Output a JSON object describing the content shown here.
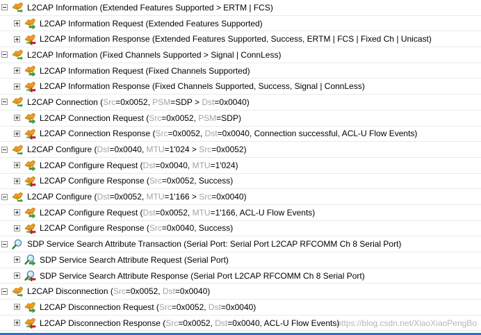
{
  "rows": [
    {
      "level": 0,
      "icon": "l2cap-icon",
      "segments": [
        {
          "t": "L2CAP Information (Extended Features Supported > ERTM | FCS)"
        }
      ]
    },
    {
      "level": 1,
      "icon": "l2cap-request-icon",
      "segments": [
        {
          "t": "L2CAP Information Request (Extended Features Supported)"
        }
      ]
    },
    {
      "level": 1,
      "icon": "l2cap-response-icon",
      "segments": [
        {
          "t": "L2CAP Information Response (Extended Features Supported, Success, ERTM | FCS | Fixed Ch | Unicast)"
        }
      ]
    },
    {
      "level": 0,
      "icon": "l2cap-icon",
      "segments": [
        {
          "t": "L2CAP Information (Fixed Channels Supported > Signal | ConnLess)"
        }
      ]
    },
    {
      "level": 1,
      "icon": "l2cap-request-icon",
      "segments": [
        {
          "t": "L2CAP Information Request (Fixed Channels Supported)"
        }
      ]
    },
    {
      "level": 1,
      "icon": "l2cap-response-icon",
      "segments": [
        {
          "t": "L2CAP Information Response (Fixed Channels Supported, Success, Signal | ConnLess)"
        }
      ]
    },
    {
      "level": 0,
      "icon": "l2cap-icon",
      "segments": [
        {
          "t": "L2CAP Connection ("
        },
        {
          "t": "Src",
          "k": true
        },
        {
          "t": "=0x0052, "
        },
        {
          "t": "PSM",
          "k": true
        },
        {
          "t": "=SDP > "
        },
        {
          "t": "Dst",
          "k": true
        },
        {
          "t": "=0x0040)"
        }
      ]
    },
    {
      "level": 1,
      "icon": "l2cap-request-icon",
      "segments": [
        {
          "t": "L2CAP Connection Request ("
        },
        {
          "t": "Src",
          "k": true
        },
        {
          "t": "=0x0052, "
        },
        {
          "t": "PSM",
          "k": true
        },
        {
          "t": "=SDP)"
        }
      ]
    },
    {
      "level": 1,
      "icon": "l2cap-response-icon",
      "segments": [
        {
          "t": "L2CAP Connection Response ("
        },
        {
          "t": "Src",
          "k": true
        },
        {
          "t": "=0x0052, "
        },
        {
          "t": "Dst",
          "k": true
        },
        {
          "t": "=0x0040, Connection successful, ACL-U Flow Events)"
        }
      ]
    },
    {
      "level": 0,
      "icon": "l2cap-icon",
      "segments": [
        {
          "t": "L2CAP Configure ("
        },
        {
          "t": "Dst",
          "k": true
        },
        {
          "t": "=0x0040, "
        },
        {
          "t": "MTU",
          "k": true
        },
        {
          "t": "=1'024 > "
        },
        {
          "t": "Src",
          "k": true
        },
        {
          "t": "=0x0052)"
        }
      ]
    },
    {
      "level": 1,
      "icon": "l2cap-request-icon",
      "segments": [
        {
          "t": "L2CAP Configure Request ("
        },
        {
          "t": "Dst",
          "k": true
        },
        {
          "t": "=0x0040, "
        },
        {
          "t": "MTU",
          "k": true
        },
        {
          "t": "=1'024)"
        }
      ]
    },
    {
      "level": 1,
      "icon": "l2cap-response-icon",
      "segments": [
        {
          "t": "L2CAP Configure Response ("
        },
        {
          "t": "Src",
          "k": true
        },
        {
          "t": "=0x0052, Success)"
        }
      ]
    },
    {
      "level": 0,
      "icon": "l2cap-icon",
      "segments": [
        {
          "t": "L2CAP Configure ("
        },
        {
          "t": "Dst",
          "k": true
        },
        {
          "t": "=0x0052, "
        },
        {
          "t": "MTU",
          "k": true
        },
        {
          "t": "=1'166 > "
        },
        {
          "t": "Src",
          "k": true
        },
        {
          "t": "=0x0040)"
        }
      ]
    },
    {
      "level": 1,
      "icon": "l2cap-request-icon",
      "segments": [
        {
          "t": "L2CAP Configure Request ("
        },
        {
          "t": "Dst",
          "k": true
        },
        {
          "t": "=0x0052, "
        },
        {
          "t": "MTU",
          "k": true
        },
        {
          "t": "=1'166, ACL-U Flow Events)"
        }
      ]
    },
    {
      "level": 1,
      "icon": "l2cap-response-icon",
      "segments": [
        {
          "t": "L2CAP Configure Response ("
        },
        {
          "t": "Src",
          "k": true
        },
        {
          "t": "=0x0040, Success)"
        }
      ]
    },
    {
      "level": 0,
      "icon": "sdp-icon",
      "segments": [
        {
          "t": "SDP Service Search Attribute Transaction (Serial Port: Serial Port L2CAP RFCOMM Ch 8 Serial Port)"
        }
      ]
    },
    {
      "level": 1,
      "icon": "sdp-request-icon",
      "segments": [
        {
          "t": "SDP Service Search Attribute Request (Serial Port)"
        }
      ]
    },
    {
      "level": 1,
      "icon": "sdp-response-icon",
      "segments": [
        {
          "t": "SDP Service Search Attribute Response (Serial Port L2CAP RFCOMM Ch 8 Serial Port)"
        }
      ]
    },
    {
      "level": 0,
      "icon": "l2cap-icon",
      "segments": [
        {
          "t": "L2CAP Disconnection ("
        },
        {
          "t": "Src",
          "k": true
        },
        {
          "t": "=0x0052, "
        },
        {
          "t": "Dst",
          "k": true
        },
        {
          "t": "=0x0040)"
        }
      ]
    },
    {
      "level": 1,
      "icon": "l2cap-request-icon",
      "segments": [
        {
          "t": "L2CAP Disconnection Request ("
        },
        {
          "t": "Src",
          "k": true
        },
        {
          "t": "=0x0052, "
        },
        {
          "t": "Dst",
          "k": true
        },
        {
          "t": "=0x0040)"
        }
      ]
    },
    {
      "level": 1,
      "icon": "l2cap-response-icon",
      "segments": [
        {
          "t": "L2CAP Disconnection Response ("
        },
        {
          "t": "Src",
          "k": true
        },
        {
          "t": "=0x0052, "
        },
        {
          "t": "Dst",
          "k": true
        },
        {
          "t": "=0x0040, ACL-U Flow Events)"
        }
      ]
    }
  ],
  "watermark": "https://blog.csdn.net/XiaoXiaoPengBo",
  "colors": {
    "key_text": "#a3a3a3",
    "row_divider": "#e6ebf1",
    "accent_blue": "#2f6fd0",
    "icon_orange": "#f0a020",
    "icon_green": "#3aa53a",
    "icon_red": "#cc2222"
  }
}
